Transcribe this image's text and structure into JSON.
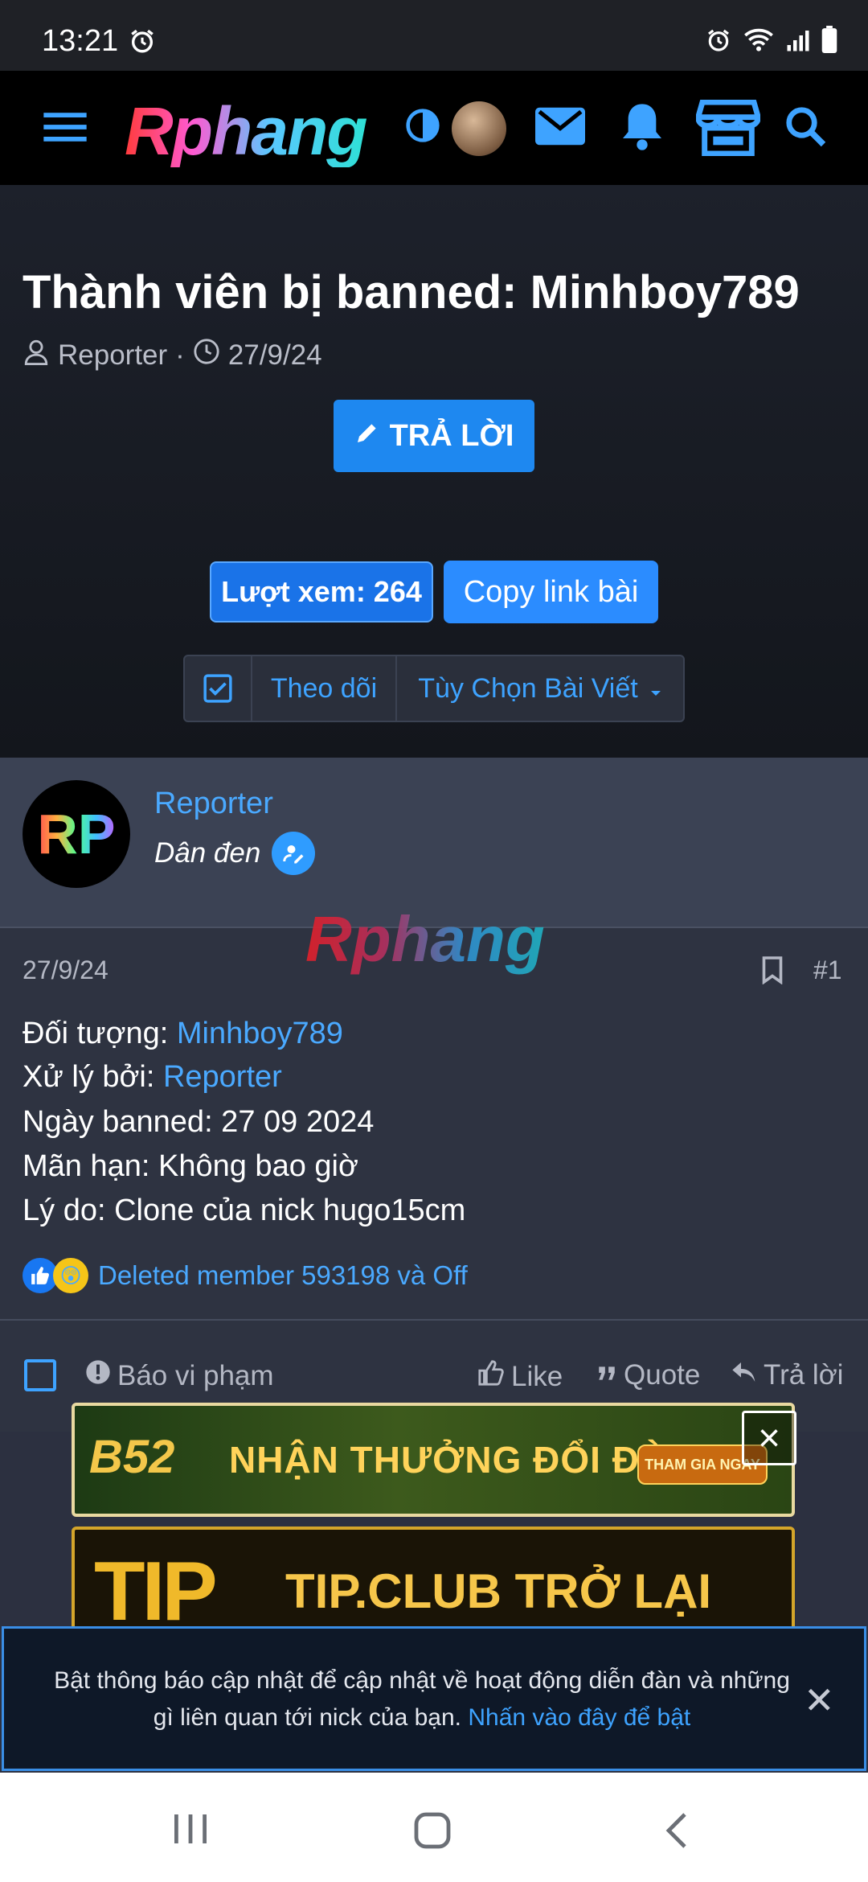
{
  "status_bar": {
    "time": "13:21"
  },
  "header": {
    "logo_text": "Rphang",
    "icons": [
      "menu-icon",
      "theme-toggle-icon",
      "avatar",
      "mail-icon",
      "bell-icon",
      "store-icon",
      "search-icon"
    ]
  },
  "thread": {
    "title": "Thành viên bị banned: Minhboy789",
    "author": "Reporter",
    "separator": "·",
    "date": "27/9/24",
    "reply_button": "TRẢ LỜI",
    "views_button": "Lượt xem: 264",
    "copy_link_button": "Copy link bài",
    "follow_label": "Theo dõi",
    "options_label": "Tùy Chọn Bài Viết"
  },
  "post": {
    "avatar_text": "RP",
    "author": "Reporter",
    "rank": "Dân đen",
    "watermark": "Rphang",
    "date": "27/9/24",
    "number": "#1",
    "lines": {
      "target_label": "Đối tượng: ",
      "target_value": "Minhboy789",
      "handled_label": "Xử lý bởi: ",
      "handled_value": "Reporter",
      "banned_date": "Ngày banned: 27 09 2024",
      "expiry": "Mãn hạn: Không bao giờ",
      "reason": "Lý do: Clone của nick hugo15cm"
    },
    "reactions_text": "Deleted member 593198 và Off",
    "footer": {
      "report": "Báo vi phạm",
      "like": "Like",
      "quote": "Quote",
      "reply": "Trả lời"
    }
  },
  "ads": {
    "banner1_brand": "B52",
    "banner1_text": "NHẬN THƯỞNG ĐỔI ĐỜI",
    "banner1_cta": "THAM GIA NGAY",
    "banner2_brand": "TIP",
    "banner2_text": "TIP.CLUB TRỞ LẠI"
  },
  "notice": {
    "message": "Bật thông báo cập nhật để cập nhật về hoạt động diễn đàn và những gì liên quan tới nick của bạn. ",
    "link": "Nhấn vào đây để bật"
  },
  "colors": {
    "accent": "#1e88f0",
    "link": "#4aa9ff",
    "header_bg": "#000000",
    "page_bg": "#2e3341"
  }
}
